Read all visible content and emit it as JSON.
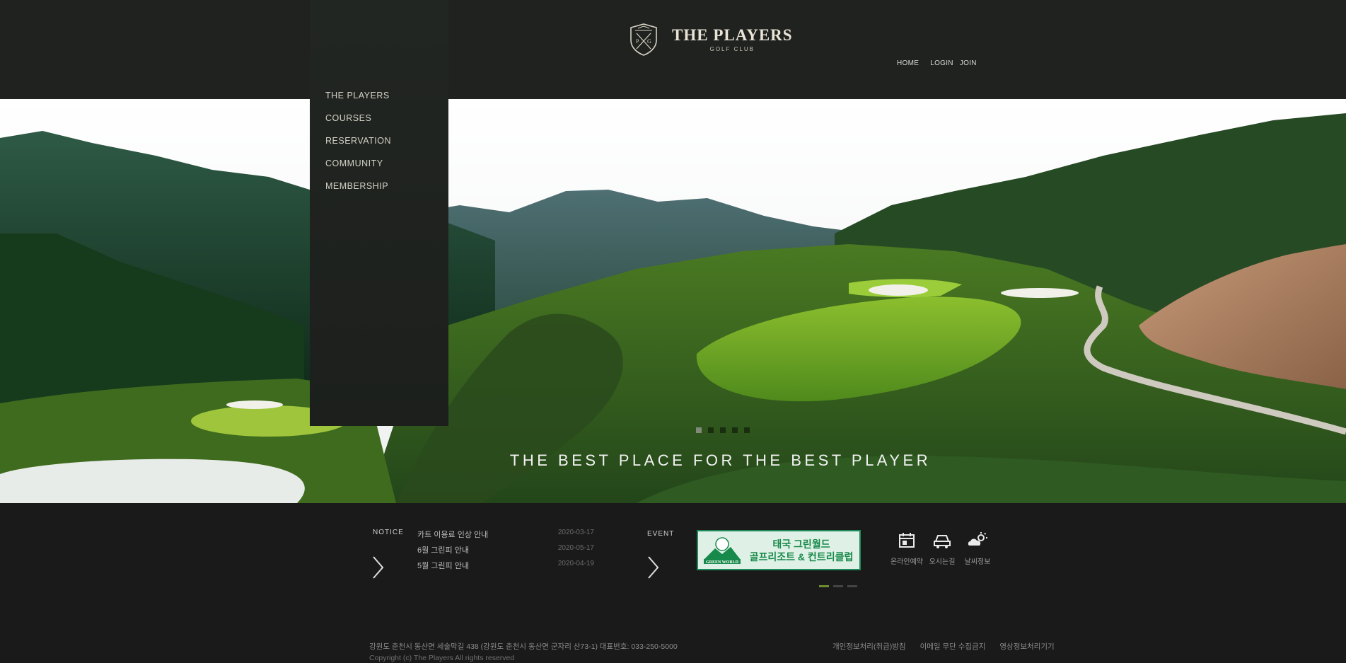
{
  "header": {
    "logo_title": "THE PLAYERS",
    "logo_subtitle": "GOLF CLUB",
    "util_nav": [
      "HOME",
      "LOGIN",
      "JOIN"
    ]
  },
  "side_menu": {
    "items": [
      "THE PLAYERS",
      "COURSES",
      "RESERVATION",
      "COMMUNITY",
      "MEMBERSHIP"
    ]
  },
  "hero": {
    "tagline": "THE BEST PLACE FOR THE BEST PLAYER",
    "slide_count": 5,
    "active_slide": 1
  },
  "notice": {
    "label": "NOTICE",
    "items": [
      {
        "title": "카트 이용료 인상 안내",
        "date": "2020-03-17"
      },
      {
        "title": "6월 그린피 안내",
        "date": "2020-05-17"
      },
      {
        "title": "5월 그린피 안내",
        "date": "2020-04-19"
      }
    ]
  },
  "event": {
    "label": "EVENT",
    "banner_line1": "태국 그린월드",
    "banner_line2": "골프리조트 & 컨트리클럽",
    "banner_logo_text": "GREEN WORLD",
    "banner_count": 3,
    "active_banner": 1,
    "accent_color": "#1e8a5a"
  },
  "quick_links": [
    {
      "icon": "reservation-icon",
      "label": "온라인예약"
    },
    {
      "icon": "car-icon",
      "label": "오시는길"
    },
    {
      "icon": "weather-icon",
      "label": "날씨정보"
    }
  ],
  "footer": {
    "address": "강원도 춘천시 동산면 세술막길 438 (강원도 춘천시 동산면 군자리 산73-1)   대표번호: 033-250-5000",
    "copyright": "Copyright (c) The Players All rights reserved",
    "links": [
      "개인정보처리(취급)방침",
      "이메일 무단 수집금지",
      "영상정보처리기기"
    ]
  }
}
